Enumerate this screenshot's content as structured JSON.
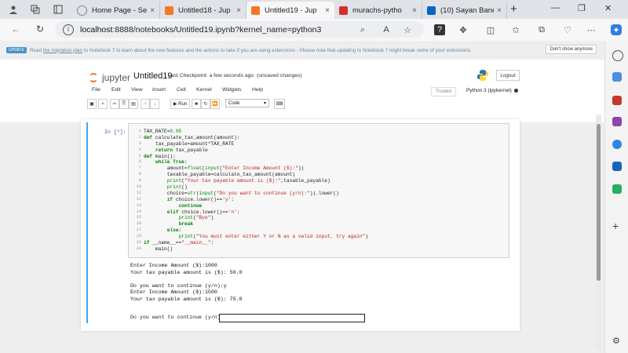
{
  "browser": {
    "tabs": [
      {
        "title": "Home Page - Se",
        "close": "×"
      },
      {
        "title": "Untitled18 - Jup",
        "close": "×"
      },
      {
        "title": "Untitled19 - Jup",
        "close": "×"
      },
      {
        "title": "murachs-pytho",
        "close": "×"
      },
      {
        "title": "(10) Sayan Bane",
        "close": "×"
      }
    ],
    "new_tab": "+",
    "address": {
      "host": "localhost",
      "rest": ":8888/notebooks/Untitled19.ipynb?kernel_name=python3"
    },
    "colors": {
      "accent": "#42a5f5",
      "jupyter_orange": "#f37726"
    }
  },
  "banner": {
    "badge": "UPDATE",
    "pre": "Read",
    "link": "the migration plan",
    "post": "to Notebook 7 to learn about the new features and the actions to take if you are using extensions - Please note that updating to Notebook 7 might break some of your extensions.",
    "dismiss": "Don't show anymore"
  },
  "header": {
    "brand": "jupyter",
    "notebook_name": "Untitled19",
    "checkpoint": "Last Checkpoint: a few seconds ago",
    "status": "(unsaved changes)",
    "logout": "Logout",
    "trusted": "Trusted",
    "kernel": "Python 3 (ipykernel)"
  },
  "menus": [
    "File",
    "Edit",
    "View",
    "Insert",
    "Cell",
    "Kernel",
    "Widgets",
    "Help"
  ],
  "toolbar": {
    "run_label": "Run",
    "cell_type": "Code"
  },
  "cell": {
    "prompt": "In [*]:",
    "line_numbers": [
      "1",
      "2",
      "3",
      "4",
      "5",
      "6",
      "7",
      "8",
      "9",
      "10",
      "11",
      "12",
      "13",
      "14",
      "15",
      "16",
      "17",
      "18",
      "19",
      "20"
    ],
    "code": [
      "TAX_RATE=0.05",
      "def calculate_tax_amount(amount):",
      "    tax_payable=amount*TAX_RATE",
      "    return tax_payable",
      "def main():",
      "    while True:",
      "        amount=float(input(\"Enter Income Amount ($):\"))",
      "        taxable_payable=calculate_tax_amount(amount)",
      "        print(\"Your tax payable amount is ($):\",taxable_payable)",
      "        print()",
      "        choice=str(input(\"Do you want to continue (y/n):\")).lower()",
      "        if choice.lower()=='y':",
      "            continue",
      "        elif choice.lower()=='n':",
      "            print(\"Bye\")",
      "            break",
      "        else:",
      "            print(\"You must enter either Y or N as a valid input, try again\")",
      "if __name__==\"__main__\":",
      "    main()"
    ],
    "output": [
      "Enter Income Amount ($):1000",
      "Your tax payable amount is ($): 50.0",
      "",
      "Do you want to continue (y/n):y",
      "Enter Income Amount ($):1500",
      "Your tax payable amount is ($): 75.0"
    ],
    "input_prompt": "Do you want to continue (y/n): ",
    "input_value": ""
  }
}
